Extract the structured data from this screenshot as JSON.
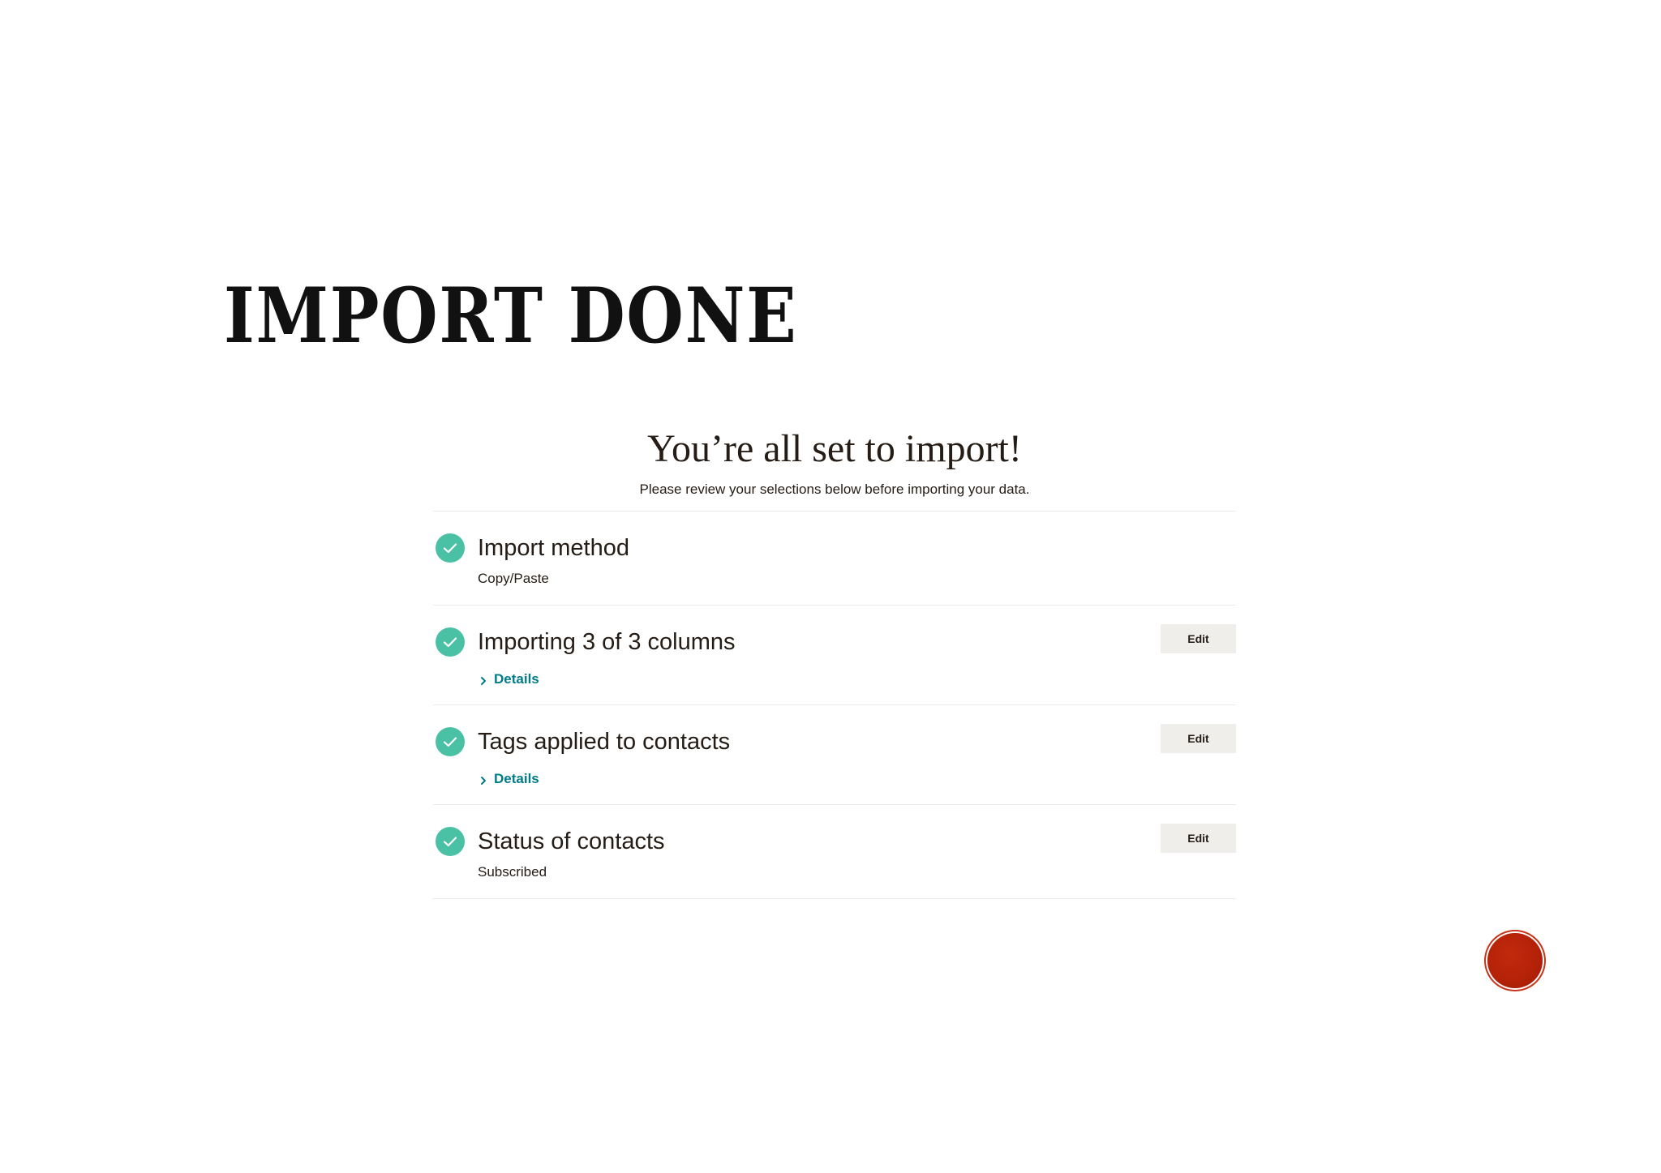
{
  "slide": {
    "title": "IMPORT DONE"
  },
  "panel": {
    "heading": "You’re all set to import!",
    "subheading": "Please review your selections below before importing your data.",
    "steps": [
      {
        "title": "Import method",
        "value": "Copy/Paste",
        "status": "complete",
        "icon": "check-circle-icon"
      },
      {
        "title": "Importing 3 of 3 columns",
        "details_label": "Details",
        "edit_label": "Edit",
        "status": "complete",
        "icon": "check-circle-icon"
      },
      {
        "title": "Tags applied to contacts",
        "details_label": "Details",
        "edit_label": "Edit",
        "status": "complete",
        "icon": "check-circle-icon"
      },
      {
        "title": "Status of contacts",
        "value": "Subscribed",
        "edit_label": "Edit",
        "status": "complete",
        "icon": "check-circle-icon"
      }
    ]
  },
  "colors": {
    "check": "#4ac1a4",
    "link": "#007c89",
    "edit_button_bg": "#efeeea",
    "record_button": "#b52208"
  },
  "record_button": {
    "icon": "record-button-icon"
  }
}
